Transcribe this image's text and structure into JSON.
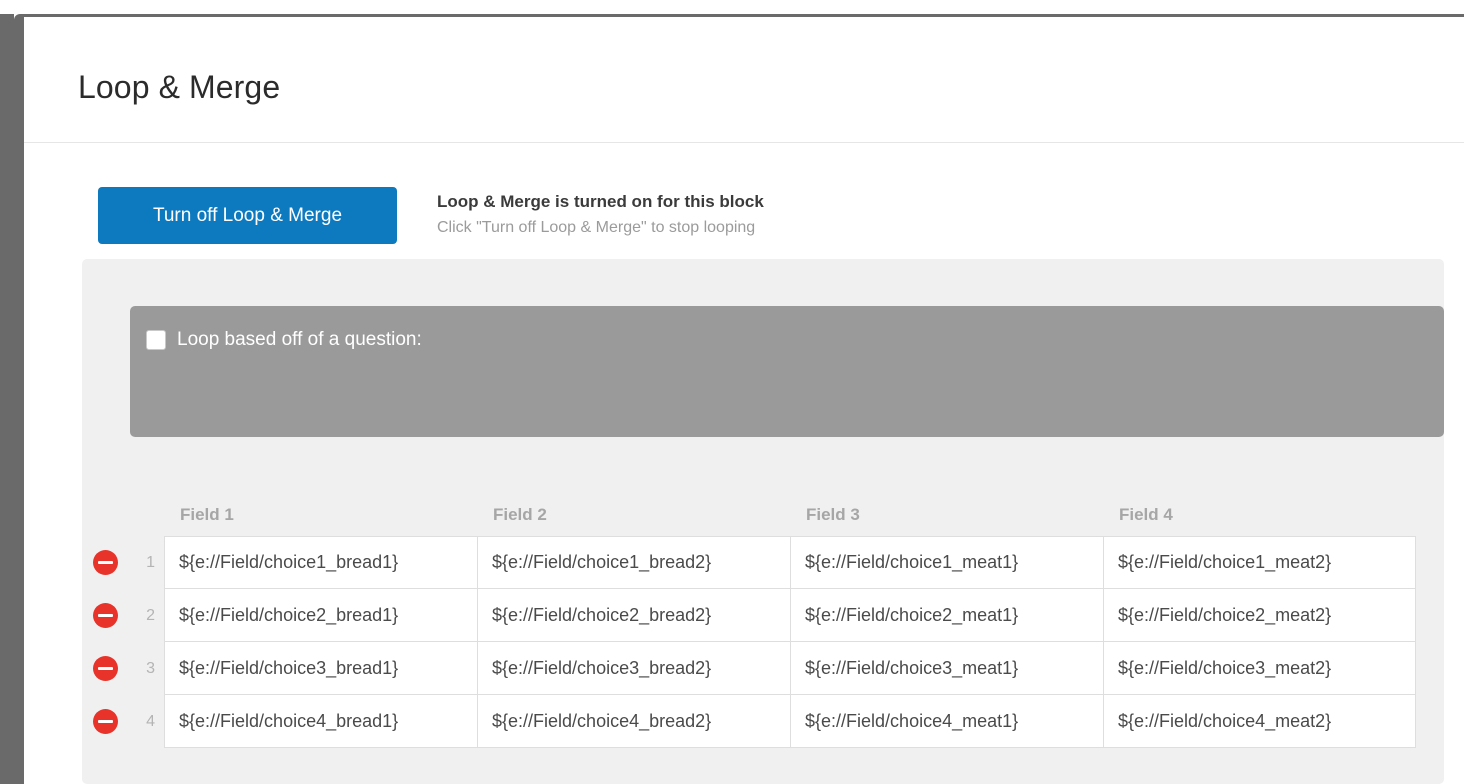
{
  "dialog": {
    "title": "Loop & Merge"
  },
  "toggle": {
    "button_label": "Turn off Loop & Merge",
    "status_title": "Loop & Merge is turned on for this block",
    "status_sub": "Click \"Turn off Loop & Merge\" to stop looping",
    "button_color": "#0d7ac0"
  },
  "question": {
    "label": "Loop based off of a question:",
    "checked": false
  },
  "table": {
    "headers": [
      "Field 1",
      "Field 2",
      "Field 3",
      "Field 4"
    ],
    "rows": [
      {
        "number": "1",
        "cells": [
          "${e://Field/choice1_bread1}",
          "${e://Field/choice1_bread2}",
          "${e://Field/choice1_meat1}",
          "${e://Field/choice1_meat2}"
        ]
      },
      {
        "number": "2",
        "cells": [
          "${e://Field/choice2_bread1}",
          "${e://Field/choice2_bread2}",
          "${e://Field/choice2_meat1}",
          "${e://Field/choice2_meat2}"
        ]
      },
      {
        "number": "3",
        "cells": [
          "${e://Field/choice3_bread1}",
          "${e://Field/choice3_bread2}",
          "${e://Field/choice3_meat1}",
          "${e://Field/choice3_meat2}"
        ]
      },
      {
        "number": "4",
        "cells": [
          "${e://Field/choice4_bread1}",
          "${e://Field/choice4_bread2}",
          "${e://Field/choice4_meat1}",
          "${e://Field/choice4_meat2}"
        ]
      }
    ]
  },
  "icons": {
    "remove": "remove-circle-icon"
  }
}
